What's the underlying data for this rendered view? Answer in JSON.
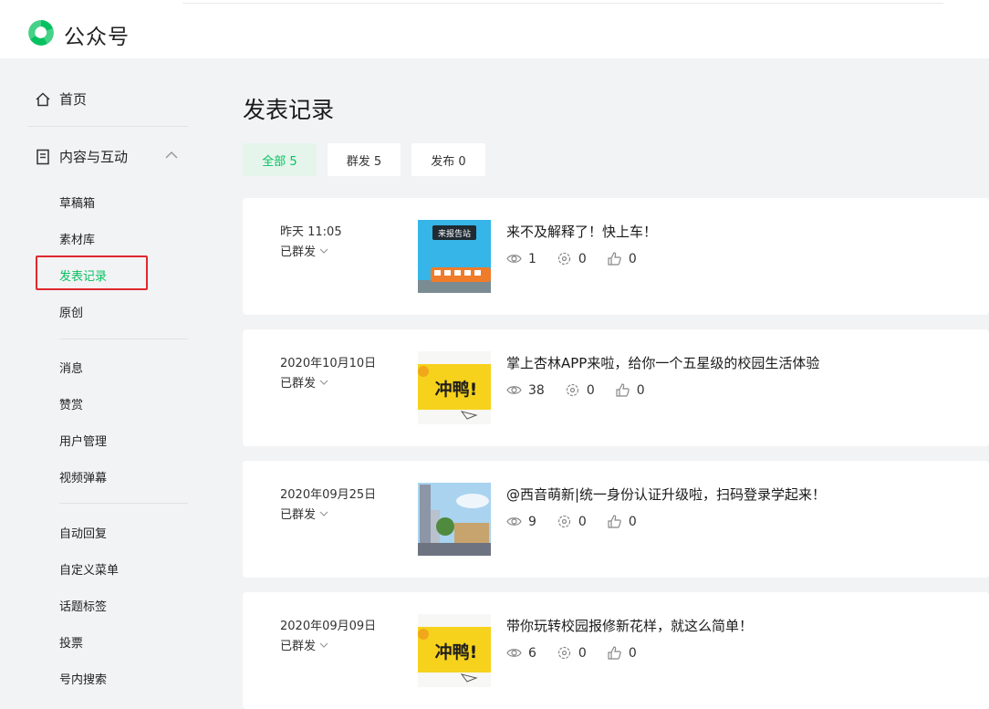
{
  "app": {
    "title": "公众号",
    "brand_color": "#07c160"
  },
  "sidebar": {
    "home": {
      "label": "首页",
      "icon": "home-icon"
    },
    "content": {
      "label": "内容与互动",
      "icon": "document-icon"
    },
    "items": [
      "草稿箱",
      "素材库",
      "发表记录",
      "原创",
      "消息",
      "赞赏",
      "用户管理",
      "视频弹幕",
      "自动回复",
      "自定义菜单",
      "话题标签",
      "投票",
      "号内搜索"
    ],
    "active": "发表记录"
  },
  "page": {
    "title": "发表记录",
    "tabs": [
      {
        "label": "全部 5",
        "active": true
      },
      {
        "label": "群发 5",
        "active": false
      },
      {
        "label": "发布 0",
        "active": false
      }
    ]
  },
  "records": [
    {
      "date": "昨天 11:05",
      "status": "已群发",
      "title": "来不及解释了！快上车！",
      "views": "1",
      "shares": "0",
      "likes": "0",
      "thumb": "train"
    },
    {
      "date": "2020年10月10日",
      "status": "已群发",
      "title": "掌上杏林APP来啦，给你一个五星级的校园生活体验",
      "views": "38",
      "shares": "0",
      "likes": "0",
      "thumb": "chongya",
      "thumb_text": "冲鸭!"
    },
    {
      "date": "2020年09月25日",
      "status": "已群发",
      "title": "@西音萌新|统一身份认证升级啦，扫码登录学起来！",
      "views": "9",
      "shares": "0",
      "likes": "0",
      "thumb": "campus"
    },
    {
      "date": "2020年09月09日",
      "status": "已群发",
      "title": "带你玩转校园报修新花样，就这么简单！",
      "views": "6",
      "shares": "0",
      "likes": "0",
      "thumb": "chongya",
      "thumb_text": "冲鸭!"
    }
  ],
  "thumb_train_label": "来报告站"
}
